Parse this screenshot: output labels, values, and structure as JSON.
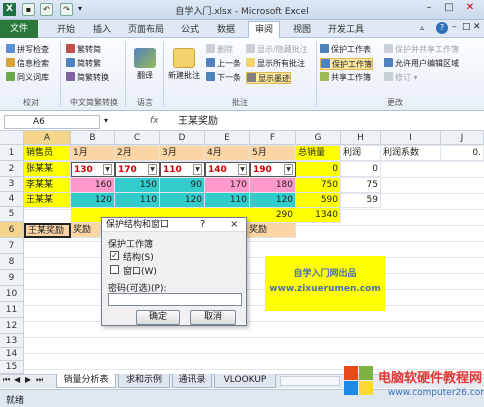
{
  "window": {
    "title": "自学入门.xlsx - Microsoft Excel"
  },
  "menu": {
    "file": "文件",
    "tabs": [
      "开始",
      "插入",
      "页面布局",
      "公式",
      "数据",
      "审阅",
      "视图",
      "开发工具"
    ],
    "active_index": 5
  },
  "ribbon": {
    "proofing": {
      "items": [
        "拼写检查",
        "信息检索",
        "同义词库"
      ],
      "label": "校对"
    },
    "chinese": {
      "items": [
        "繁转简",
        "简转繁",
        "简繁转换"
      ],
      "label": "中文简繁转换"
    },
    "language": {
      "item": "翻译",
      "label": "语言"
    },
    "comments": {
      "new": "新建批注",
      "items_a": [
        "删除",
        "上一条",
        "下一条"
      ],
      "items_b": [
        "显示/隐藏批注",
        "显示所有批注",
        "显示墨迹"
      ],
      "label": "批注"
    },
    "changes": {
      "items_a": [
        "保护工作表",
        "保护工作簿",
        "共享工作簿"
      ],
      "items_b": [
        "保护并共享工作簿",
        "允许用户编辑区域",
        "修订"
      ],
      "label": "更改"
    }
  },
  "formula_bar": {
    "name_box": "A6",
    "fx": "fx",
    "content": "王某奖励"
  },
  "sheet": {
    "columns": [
      "A",
      "B",
      "C",
      "D",
      "E",
      "F",
      "G",
      "H",
      "I",
      "J"
    ],
    "rows": [
      "1",
      "2",
      "3",
      "4",
      "5",
      "6",
      "7",
      "8",
      "9",
      "10",
      "11",
      "12",
      "13",
      "14",
      "15"
    ],
    "header_row": [
      "销售员",
      "1月",
      "2月",
      "3月",
      "4月",
      "5月",
      "总销量",
      "利润",
      "利润系数",
      "0."
    ],
    "row2": [
      "张某某",
      "130",
      "170",
      "110",
      "140",
      "190",
      "0",
      "0"
    ],
    "row3": [
      "李某某",
      "160",
      "150",
      "90",
      "170",
      "180",
      "750",
      "75"
    ],
    "row4": [
      "王某某",
      "120",
      "110",
      "120",
      "110",
      "120",
      "590",
      "59"
    ],
    "row5": [
      "290",
      "1340"
    ],
    "row6": [
      "王某奖励",
      "奖励",
      "奖励"
    ]
  },
  "dialog": {
    "title": "保护结构和窗口",
    "help": "?",
    "close": "×",
    "group_label": "保护工作簿",
    "opt_structure": "结构(S)",
    "opt_window": "窗口(W)",
    "structure_checked": true,
    "window_checked": false,
    "password_label": "密码(可选)(P):",
    "password_value": "",
    "ok": "确定",
    "cancel": "取消"
  },
  "callout": {
    "line1": "自学入门网出品",
    "line2": "www.zixuerumen.com"
  },
  "sheet_tabs": [
    "销量分析表",
    "求和示例",
    "通讯录",
    "VLOOKUP"
  ],
  "status": {
    "ready": "就绪"
  },
  "watermark": {
    "line1": "电脑软硬件教程网",
    "line2": "www.computer26.com"
  }
}
